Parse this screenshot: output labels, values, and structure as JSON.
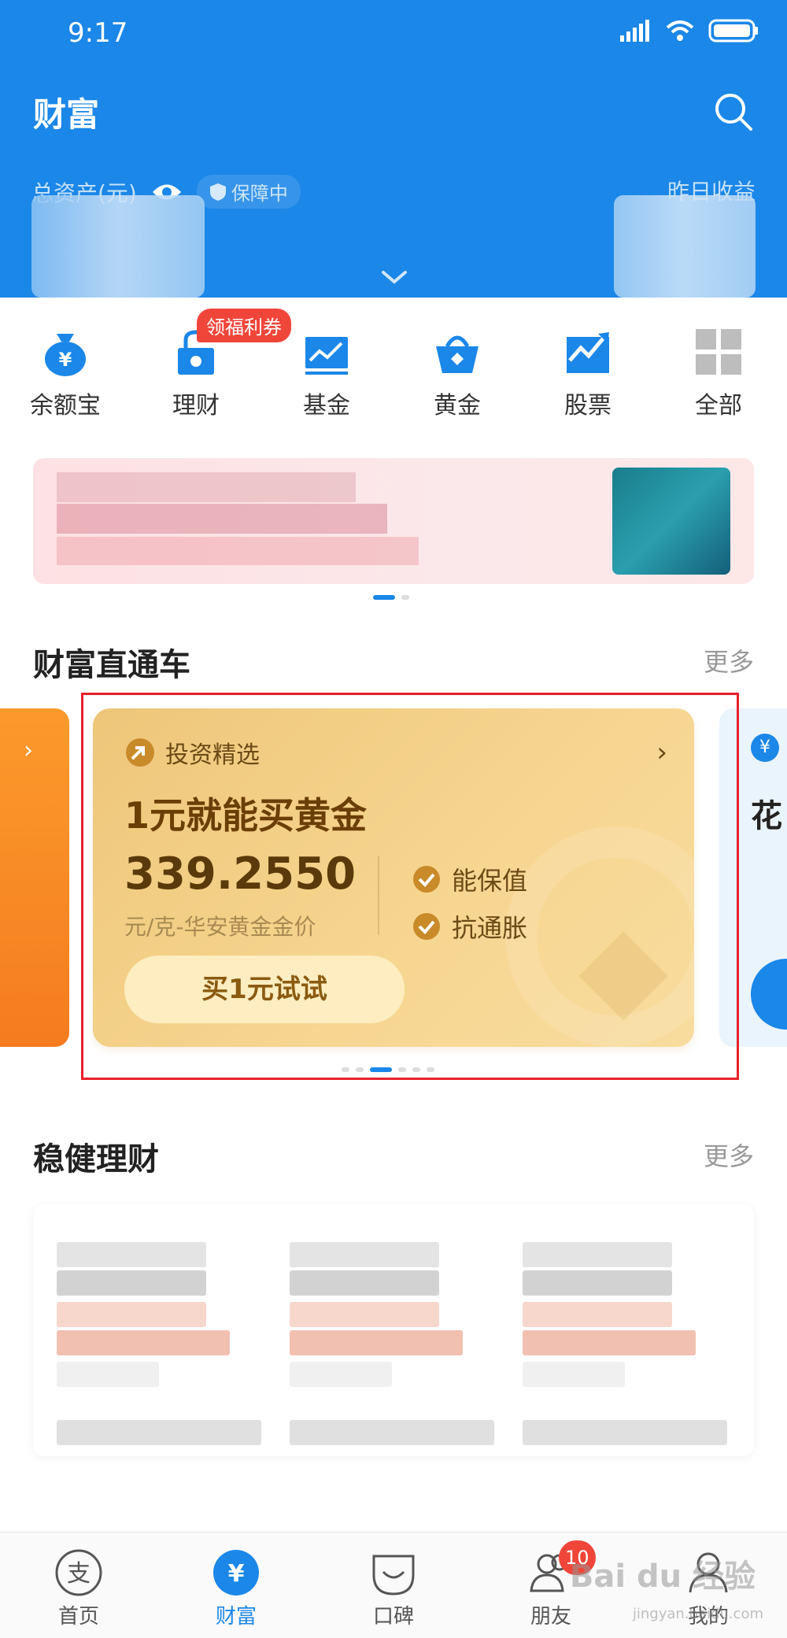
{
  "status_bar": {
    "time": "9:17"
  },
  "header": {
    "title": "财富",
    "total_assets_label": "总资产(元)",
    "guard_label": "保障中",
    "yesterday_label": "昨日收益"
  },
  "quick_menu": {
    "promo_badge": "领福利券",
    "items": [
      {
        "label": "余额宝",
        "icon": "yuebao-bag-icon"
      },
      {
        "label": "理财",
        "icon": "wealth-lock-icon"
      },
      {
        "label": "基金",
        "icon": "fund-chart-icon"
      },
      {
        "label": "黄金",
        "icon": "gold-basket-icon"
      },
      {
        "label": "股票",
        "icon": "stock-trend-icon"
      },
      {
        "label": "全部",
        "icon": "grid-icon"
      }
    ]
  },
  "section_express": {
    "title": "财富直通车",
    "more": "更多"
  },
  "gold_card": {
    "tag": "投资精选",
    "title": "1元就能买黄金",
    "price": "339.2550",
    "unit": "元/克-华安黄金金价",
    "features": [
      "能保值",
      "抗通胀"
    ],
    "button": "买1元试试"
  },
  "side_card_right": {
    "title_fragment": "花"
  },
  "section_stable": {
    "title": "稳健理财",
    "more": "更多"
  },
  "bottom_nav": {
    "items": [
      {
        "label": "首页",
        "icon": "alipay-home-icon"
      },
      {
        "label": "财富",
        "icon": "yen-wealth-icon"
      },
      {
        "label": "口碑",
        "icon": "koubei-smile-icon"
      },
      {
        "label": "朋友",
        "icon": "friends-icon",
        "badge": "10"
      },
      {
        "label": "我的",
        "icon": "profile-icon"
      }
    ]
  },
  "watermark": {
    "text": "Bai du 经验",
    "sub": "jingyan.baidu.com"
  },
  "colors": {
    "brand_blue": "#1b87e8",
    "badge_red": "#f0463a",
    "gold": "#f6d58f",
    "highlight_red": "#e8202c"
  }
}
